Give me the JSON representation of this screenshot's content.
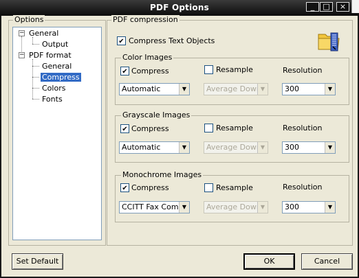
{
  "window": {
    "title": "PDF Options"
  },
  "options": {
    "label": "Options",
    "tree": {
      "general": "General",
      "general_output": "Output",
      "pdf_format": "PDF format",
      "pdf_general": "General",
      "pdf_compress": "Compress",
      "pdf_colors": "Colors",
      "pdf_fonts": "Fonts"
    }
  },
  "compression": {
    "label": "PDF compression",
    "compress_text": {
      "label": "Compress Text Objects",
      "checked": true
    },
    "groups": [
      {
        "label": "Color Images",
        "compress": "Compress",
        "resample": "Resample",
        "resolution": "Resolution",
        "method": "Automatic",
        "downsample": "Average Down:",
        "dpi": "300"
      },
      {
        "label": "Grayscale Images",
        "compress": "Compress",
        "resample": "Resample",
        "resolution": "Resolution",
        "method": "Automatic",
        "downsample": "Average Down:",
        "dpi": "300"
      },
      {
        "label": "Monochrome Images",
        "compress": "Compress",
        "resample": "Resample",
        "resolution": "Resolution",
        "method": "CCITT Fax Comp",
        "downsample": "Average Down:",
        "dpi": "300"
      }
    ]
  },
  "buttons": {
    "set_default": "Set Default",
    "ok": "OK",
    "cancel": "Cancel"
  },
  "icons": {
    "minimize": "minimize-icon",
    "maximize": "maximize-icon",
    "close": "close-icon",
    "zip": "zip-folder-icon"
  },
  "colors": {
    "titlebar": "#1a1a1a",
    "selection": "#316ac5",
    "face": "#ece9d8"
  }
}
